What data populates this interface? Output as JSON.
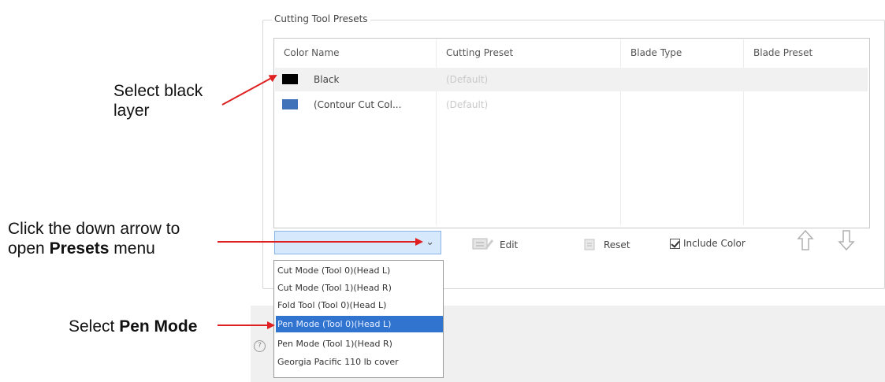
{
  "annotations": {
    "select_black_line1": "Select black",
    "select_black_line2": "layer",
    "click_arrow_line1": "Click the down arrow to",
    "click_arrow_line2_pre": "open ",
    "click_arrow_line2_bold": "Presets",
    "click_arrow_line2_post": " menu",
    "select_pen_pre": "Select ",
    "select_pen_bold": "Pen Mode"
  },
  "group": {
    "title": "Cutting Tool Presets"
  },
  "table": {
    "headers": [
      "Color Name",
      "Cutting Preset",
      "Blade Type",
      "Blade Preset"
    ],
    "rows": [
      {
        "color": "#000000",
        "name": "Black",
        "preset": "(Default)"
      },
      {
        "color": "#3f72b8",
        "name": "(Contour Cut Col...",
        "preset": "(Default)"
      }
    ]
  },
  "toolbar": {
    "edit_label": "Edit",
    "reset_label": "Reset",
    "include_color_label": "Include Color"
  },
  "dropdown": {
    "items": [
      "Cut Mode (Tool 0)(Head L)",
      "Cut Mode (Tool 1)(Head R)",
      "Fold Tool (Tool 0)(Head L)",
      "Pen Mode (Tool 0)(Head L)",
      "Pen Mode (Tool 1)(Head R)",
      "Georgia Pacific 110 lb cover"
    ],
    "selected_index": 3
  },
  "colors": {
    "arrow": "#e02020",
    "selection": "#3174d0"
  }
}
